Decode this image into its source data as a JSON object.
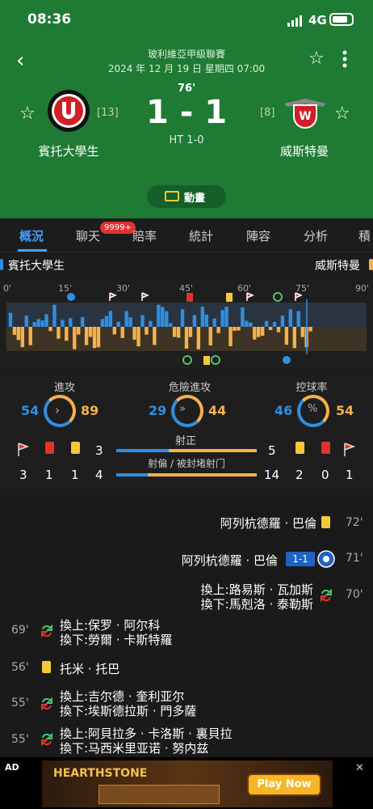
{
  "status_bar": {
    "time": "08:36",
    "network": "4G"
  },
  "header": {
    "league": "玻利維亞甲級聯賽",
    "datetime": "2024 年 12 月 19 日 星期四 07:00",
    "minute": "76'",
    "score": "1 - 1",
    "halftime": "HT 1-0",
    "home": {
      "name": "賓托大學生",
      "rank": "[13]"
    },
    "away": {
      "name": "威斯特曼",
      "rank": "[8]"
    },
    "animation_label": "動畫"
  },
  "tabs": [
    {
      "label": "概況",
      "active": true
    },
    {
      "label": "聊天",
      "badge": "9999+"
    },
    {
      "label": "賠率"
    },
    {
      "label": "統計"
    },
    {
      "label": "陣容"
    },
    {
      "label": "分析"
    },
    {
      "label": "積"
    }
  ],
  "team_row": {
    "home": "賓托大學生",
    "away": "威斯特曼"
  },
  "timeline": {
    "ticks": [
      "0'",
      "15'",
      "30'",
      "45'",
      "60'",
      "75'",
      "90'"
    ],
    "current_minute": 76
  },
  "stats": {
    "attack": {
      "label": "進攻",
      "home": "54",
      "away": "89"
    },
    "dangerous": {
      "label": "危險進攻",
      "home": "29",
      "away": "44"
    },
    "possession": {
      "label": "控球率",
      "home": "46",
      "away": "54"
    },
    "on_target": {
      "label": "射正",
      "home": "3",
      "away": "5",
      "home_val": 3,
      "away_val": 5
    },
    "off_target": {
      "label": "射偏 / 被封堵射门",
      "home": "4",
      "away": "14",
      "home_val": 4,
      "away_val": 14
    },
    "home_counts": {
      "corners": "3",
      "red": "1",
      "yellow": "1"
    },
    "away_counts": {
      "yellow": "2",
      "red": "0",
      "corners": "1"
    }
  },
  "events": [
    {
      "side": "away",
      "type": "yellow",
      "player": "阿列杭德羅 · 巴倫",
      "minute": "72'"
    },
    {
      "side": "away",
      "type": "goal",
      "player": "阿列杭德羅 · 巴倫",
      "score": "1-1",
      "minute": "71'"
    },
    {
      "side": "away",
      "type": "sub",
      "in": "換上:路易斯 · 瓦加斯",
      "out": "換下:馬剋洛 · 泰勒斯",
      "minute": "70'"
    },
    {
      "side": "home",
      "type": "sub",
      "in": "換上:保罗 · 阿尔科",
      "out": "換下:勞爾 · 卡斯特羅",
      "minute": "69'"
    },
    {
      "side": "home",
      "type": "yellow",
      "player": "托米 · 托巴",
      "minute": "56'"
    },
    {
      "side": "home",
      "type": "sub",
      "in": "換上:吉尔德 · 奎利亚尔",
      "out": "換下:埃斯德拉斯 · 門多薩",
      "minute": "55'"
    },
    {
      "side": "home",
      "type": "sub",
      "in": "換上:阿貝拉多 · 卡洛斯 · 裏貝拉",
      "out": "換下:马西米里亚诺 · 努内兹",
      "minute": "55'"
    }
  ],
  "ad": {
    "label": "AD",
    "brand": "HEARTHSTONE",
    "cta": "Play Now"
  },
  "colors": {
    "header": "#1f7a34",
    "home": "#2e8fe0",
    "away": "#f5b14a"
  }
}
